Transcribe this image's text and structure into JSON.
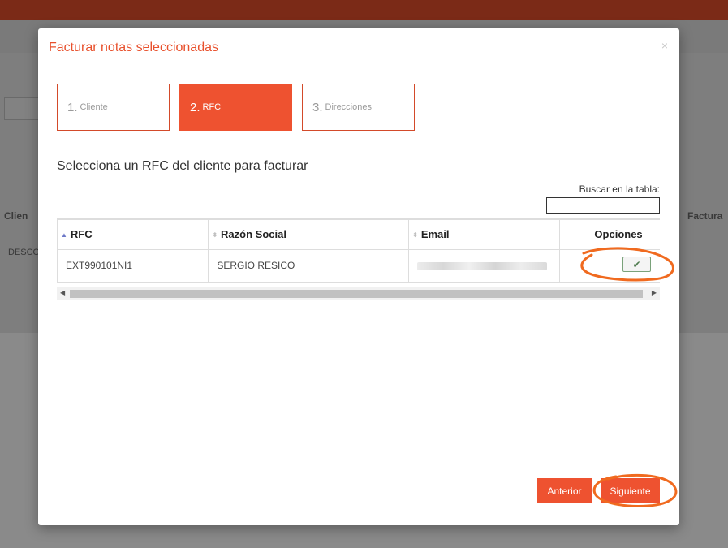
{
  "background": {
    "col_left": "Clien",
    "col_right": "Factura",
    "cell_left": "DESCO"
  },
  "modal": {
    "title": "Facturar notas seleccionadas",
    "close": "×",
    "steps": [
      {
        "num": "1.",
        "label": "Cliente",
        "active": false
      },
      {
        "num": "2.",
        "label": "RFC",
        "active": true
      },
      {
        "num": "3.",
        "label": "Direcciones",
        "active": false
      }
    ],
    "subtitle": "Selecciona un RFC del cliente para facturar",
    "search_label": "Buscar en la tabla:",
    "table": {
      "headers": [
        "RFC",
        "Razón Social",
        "Email",
        "Opciones"
      ],
      "rows": [
        {
          "rfc": "EXT990101NI1",
          "razon_social": "SERGIO RESICO"
        }
      ]
    },
    "buttons": {
      "prev": "Anterior",
      "next": "Siguiente"
    }
  },
  "colors": {
    "accent": "#ee5230",
    "title": "#e8502c",
    "annotation": "#f06a1f"
  }
}
